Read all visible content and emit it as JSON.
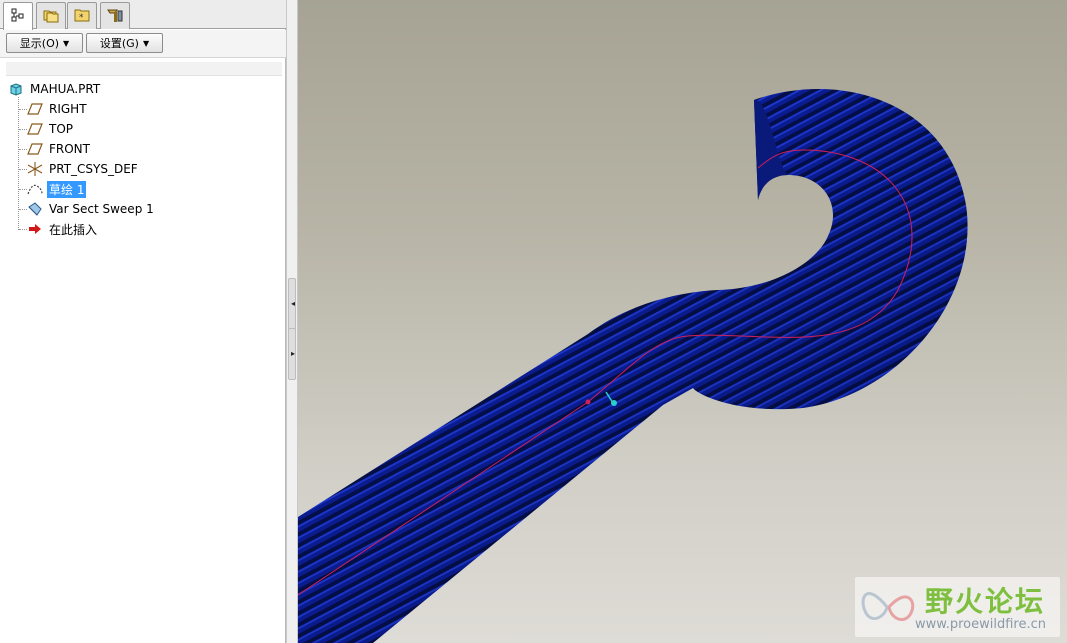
{
  "navigator": {
    "tabs": [
      {
        "name": "model-tree-tab",
        "icon": "model-tree-icon"
      },
      {
        "name": "folder-browser-tab",
        "icon": "folder-stack-icon"
      },
      {
        "name": "favorites-tab",
        "icon": "favorites-folder-icon"
      },
      {
        "name": "connections-tab",
        "icon": "tools-icon"
      }
    ],
    "buttons": {
      "display_label": "显示(O)",
      "settings_label": "设置(G)"
    },
    "tree": {
      "root": "MAHUA.PRT",
      "items": [
        {
          "label": "RIGHT",
          "icon": "datum-plane-icon"
        },
        {
          "label": "TOP",
          "icon": "datum-plane-icon"
        },
        {
          "label": "FRONT",
          "icon": "datum-plane-icon"
        },
        {
          "label": "PRT_CSYS_DEF",
          "icon": "coordinate-system-icon"
        },
        {
          "label": "草绘 1",
          "icon": "sketch-icon",
          "selected": true
        },
        {
          "label": "Var Sect Sweep 1",
          "icon": "sweep-feature-icon"
        },
        {
          "label": "在此插入",
          "icon": "insert-here-arrow-icon"
        }
      ]
    }
  },
  "watermark": {
    "title": "野火论坛",
    "url": "www.proewildfire.cn"
  },
  "colors": {
    "selection": "#3399ff",
    "sweep_body": "#0a1f9e",
    "trajectory": "#d0205a",
    "background_top": "#a6a394",
    "background_bottom": "#dedcd6"
  }
}
